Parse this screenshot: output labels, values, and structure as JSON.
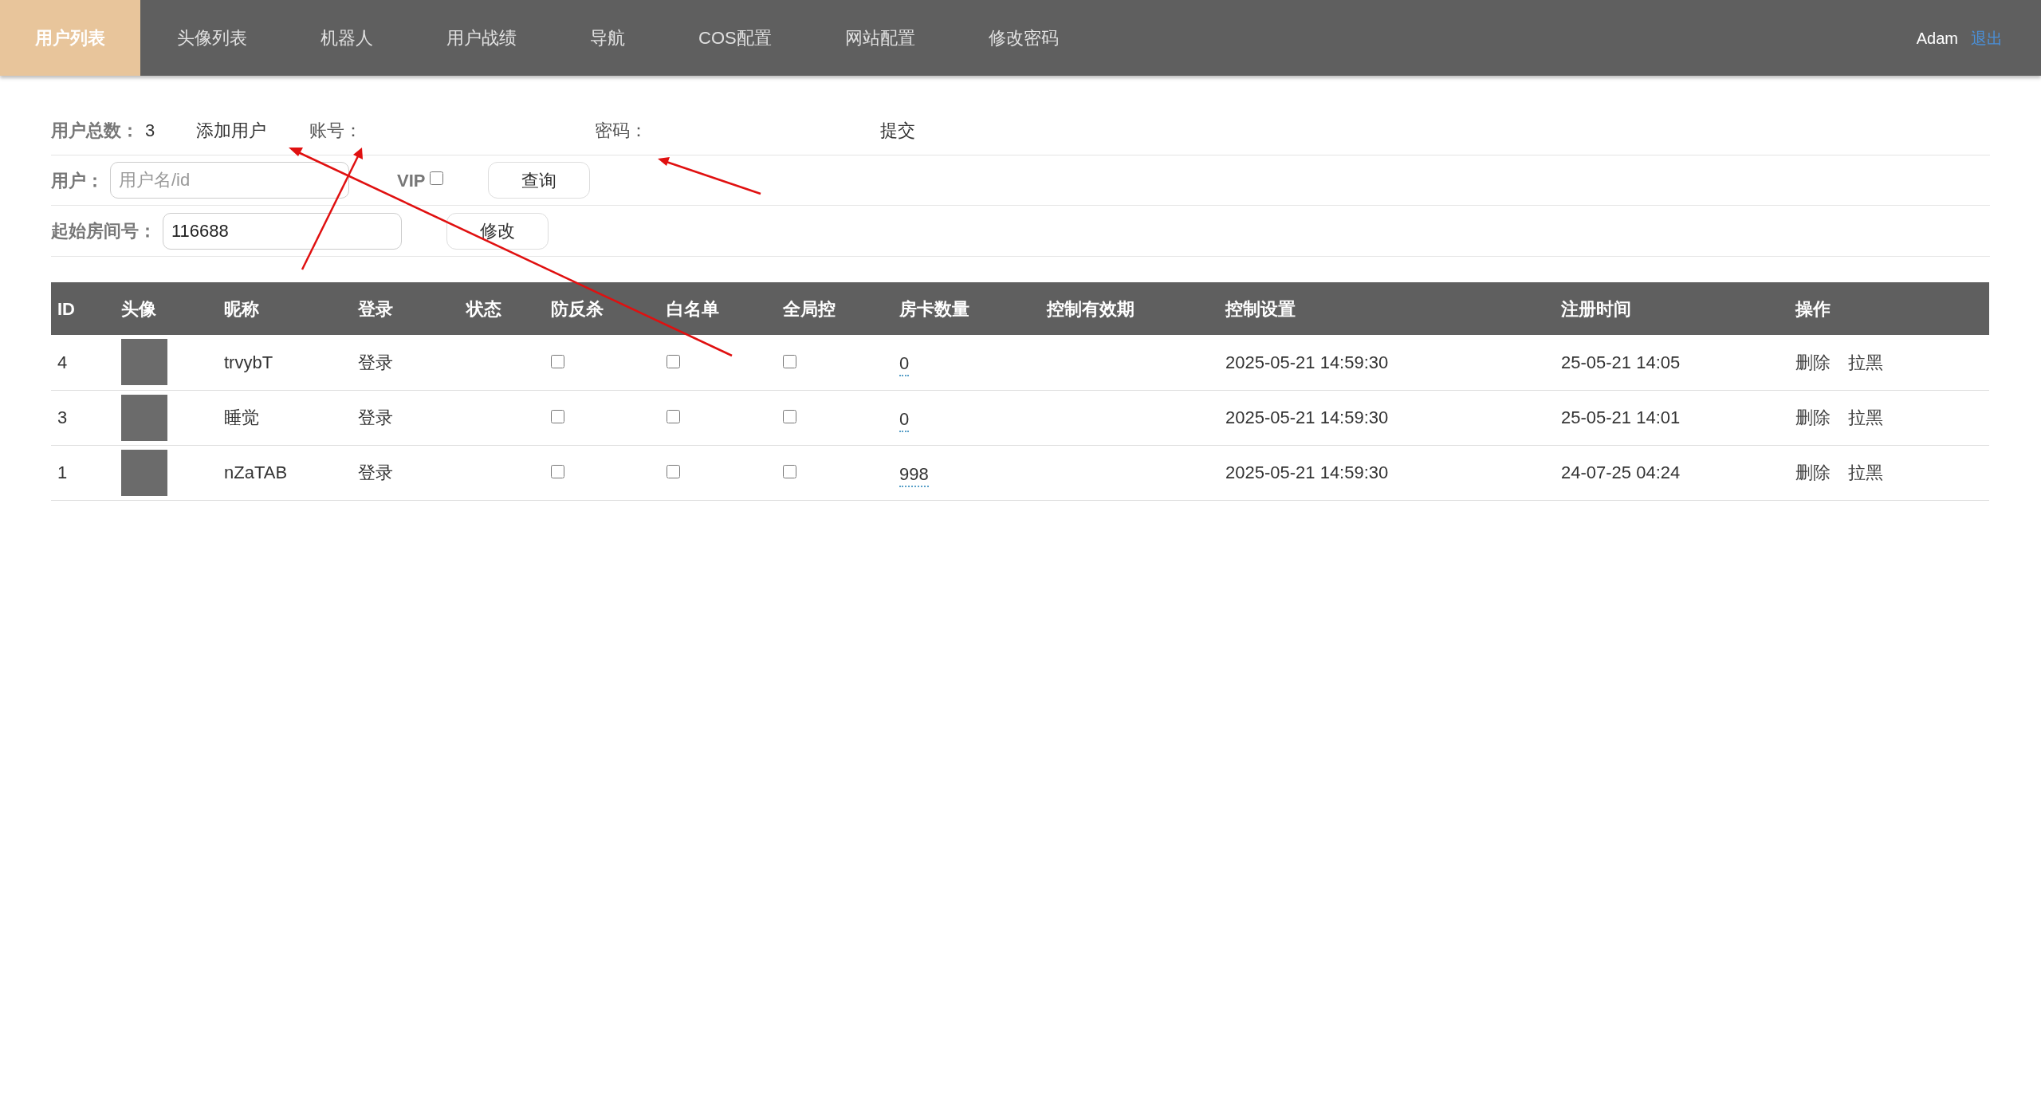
{
  "nav": {
    "tabs": [
      {
        "label": "用户列表",
        "selected": true
      },
      {
        "label": "头像列表",
        "selected": false
      },
      {
        "label": "机器人",
        "selected": false
      },
      {
        "label": "用户战绩",
        "selected": false
      },
      {
        "label": "导航",
        "selected": false
      },
      {
        "label": "COS配置",
        "selected": false
      },
      {
        "label": "网站配置",
        "selected": false
      },
      {
        "label": "修改密码",
        "selected": false
      }
    ],
    "user": "Adam",
    "logout": "退出"
  },
  "toolbar": {
    "total_label": "用户总数：",
    "total": "3",
    "add_user": "添加用户",
    "account_label": "账号：",
    "password_label": "密码：",
    "submit": "提交"
  },
  "search": {
    "label": "用户：",
    "placeholder": "用户名/id",
    "vip_label": "VIP",
    "vip_checked": false,
    "button": "查询"
  },
  "room": {
    "label": "起始房间号：",
    "value": "116688",
    "button": "修改"
  },
  "table": {
    "columns": [
      "ID",
      "头像",
      "昵称",
      "登录",
      "状态",
      "防反杀",
      "白名单",
      "全局控",
      "房卡数量",
      "控制有效期",
      "控制设置",
      "注册时间",
      "操作"
    ],
    "rows": [
      {
        "id": "4",
        "nickname": "trvybT",
        "login": "登录",
        "anti_kill": false,
        "whitelist": false,
        "global_control": false,
        "room_cards": "0",
        "control_setting": "2025-05-21 14:59:30",
        "registered": "25-05-21 14:05",
        "actions": [
          "删除",
          "拉黑"
        ]
      },
      {
        "id": "3",
        "nickname": "睡觉",
        "login": "登录",
        "anti_kill": false,
        "whitelist": false,
        "global_control": false,
        "room_cards": "0",
        "control_setting": "2025-05-21 14:59:30",
        "registered": "25-05-21 14:01",
        "actions": [
          "删除",
          "拉黑"
        ]
      },
      {
        "id": "1",
        "nickname": "nZaTAB",
        "login": "登录",
        "anti_kill": false,
        "whitelist": false,
        "global_control": false,
        "room_cards": "998",
        "control_setting": "2025-05-21 14:59:30",
        "registered": "24-07-25 04:24",
        "actions": [
          "删除",
          "拉黑"
        ]
      }
    ]
  }
}
